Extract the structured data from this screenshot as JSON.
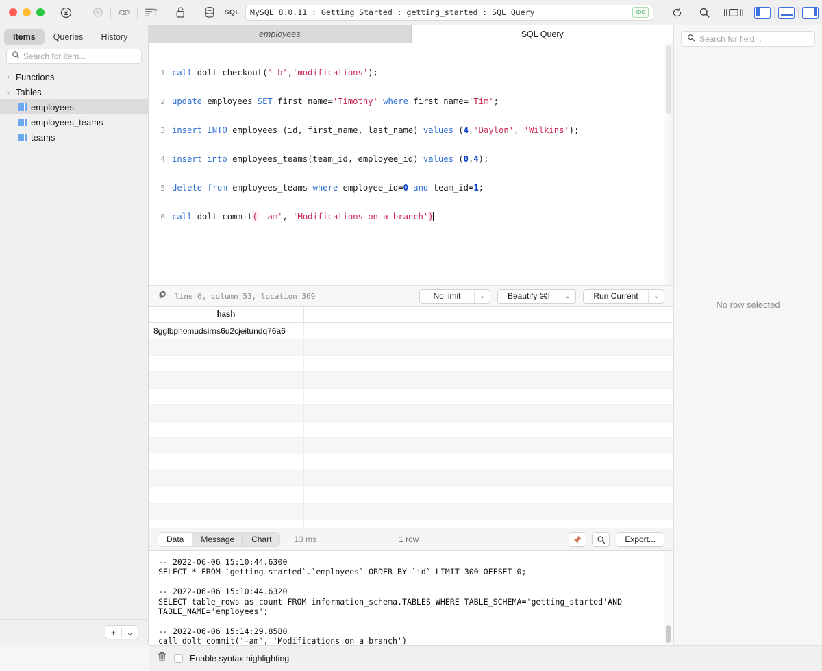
{
  "titlebar": {
    "connection": "MySQL 8.0.11 : Getting Started : getting_started : SQL Query",
    "loc_badge": "loc",
    "sql_label": "SQL",
    "icons": {
      "app": "tadpole-app-icon",
      "disconnect": "disconnect-icon",
      "eye": "eye-icon",
      "sort": "sort-ascending-icon",
      "lock": "unlock-icon",
      "database": "database-icon",
      "refresh": "refresh-icon",
      "search": "search-icon",
      "panels": "panel-toggle-icon"
    }
  },
  "sidebar": {
    "tabs": [
      {
        "label": "Items",
        "active": true
      },
      {
        "label": "Queries",
        "active": false
      },
      {
        "label": "History",
        "active": false
      }
    ],
    "search_placeholder": "Search for item...",
    "groups": [
      {
        "label": "Functions",
        "expanded": false,
        "chevron": "›"
      },
      {
        "label": "Tables",
        "expanded": true,
        "chevron": "⌄"
      }
    ],
    "tables": [
      {
        "label": "employees",
        "selected": true
      },
      {
        "label": "employees_teams",
        "selected": false
      },
      {
        "label": "teams",
        "selected": false
      }
    ],
    "add_label": "+",
    "add_chevron": "⌄"
  },
  "editor": {
    "tabs": [
      {
        "label": "employees",
        "active": false,
        "italic": true
      },
      {
        "label": "SQL Query",
        "active": true,
        "italic": false
      }
    ],
    "lines": [
      {
        "n": "1",
        "text": "call dolt_checkout('-b','modifications');"
      },
      {
        "n": "2",
        "text": "update employees SET first_name='Timothy' where first_name='Tim';"
      },
      {
        "n": "3",
        "text": "insert INTO employees (id, first_name, last_name) values (4,'Daylon', 'Wilkins');"
      },
      {
        "n": "4",
        "text": "insert into employees_teams(team_id, employee_id) values (0,4);"
      },
      {
        "n": "5",
        "text": "delete from employees_teams where employee_id=0 and team_id=1;"
      },
      {
        "n": "6",
        "text": "call dolt_commit('-am', 'Modifications on a branch')"
      }
    ],
    "status": "line 6, column 53, location 369",
    "limit_label": "No limit",
    "beautify_label": "Beautify ⌘I",
    "run_label": "Run Current",
    "chevron": "⌄",
    "gear_icon": "gear-icon"
  },
  "results": {
    "columns": [
      "hash",
      ""
    ],
    "rows": [
      [
        "8gglbpnomudsirns6u2cjeitundq76a6",
        ""
      ]
    ],
    "empty_row_count": 12,
    "tabs": [
      {
        "label": "Data",
        "active": true
      },
      {
        "label": "Message",
        "active": false
      },
      {
        "label": "Chart",
        "active": false
      }
    ],
    "duration": "13 ms",
    "row_count": "1 row",
    "pin_icon": "pin-icon",
    "search_icon": "search-icon",
    "export_label": "Export..."
  },
  "console": {
    "entries": [
      "-- 2022-06-06 15:10:44.6300",
      "SELECT * FROM `getting_started`.`employees` ORDER BY `id` LIMIT 300 OFFSET 0;",
      "",
      "-- 2022-06-06 15:10:44.6320",
      "SELECT table_rows as count FROM information_schema.TABLES WHERE TABLE_SCHEMA='getting_started'AND TABLE_NAME='employees';",
      "",
      "-- 2022-06-06 15:14:29.8580",
      "call dolt_commit('-am', 'Modifications on a branch')"
    ]
  },
  "rightpanel": {
    "search_placeholder": "Search for field...",
    "empty_message": "No row selected"
  },
  "bottombar": {
    "trash_icon": "trash-icon",
    "checkbox_label": "Enable syntax highlighting",
    "checkbox_checked": false
  },
  "colors": {
    "accent": "#3f72dd",
    "keyword": "#2f6fd0",
    "string": "#c7254e",
    "number": "#0a3fc8",
    "badge_green": "#5aa96a"
  }
}
